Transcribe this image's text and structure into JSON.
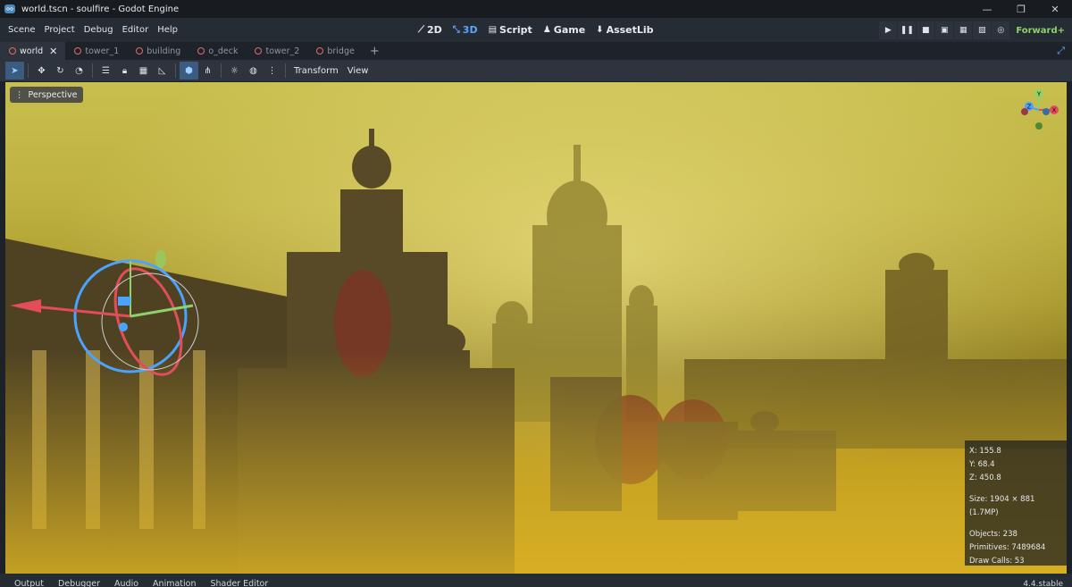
{
  "window": {
    "title": "world.tscn - soulfire - Godot Engine"
  },
  "menus": [
    "Scene",
    "Project",
    "Debug",
    "Editor",
    "Help"
  ],
  "workspaces": [
    {
      "label": "2D",
      "icon": "2d-icon"
    },
    {
      "label": "3D",
      "icon": "3d-icon"
    },
    {
      "label": "Script",
      "icon": "script-icon"
    },
    {
      "label": "Game",
      "icon": "game-icon"
    },
    {
      "label": "AssetLib",
      "icon": "assetlib-icon"
    }
  ],
  "renderer": "Forward+",
  "scene_tabs": [
    "world",
    "tower_1",
    "building",
    "o_deck",
    "tower_2",
    "bridge"
  ],
  "toolbar": {
    "transform_label": "Transform",
    "view_label": "View"
  },
  "viewport": {
    "perspective_label": "Perspective",
    "gizmo": {
      "x": "X",
      "y": "Y",
      "z": "Z"
    }
  },
  "stats": {
    "x": "X: 155.8",
    "y": "Y: 68.4",
    "z": "Z: 450.8",
    "size": "Size: 1904 × 881 (1.7MP)",
    "objects": "Objects: 238",
    "primitives": "Primitives: 7489684",
    "draw_calls": "Draw Calls: 53"
  },
  "bottom_tabs": [
    "Output",
    "Debugger",
    "Audio",
    "Animation",
    "Shader Editor"
  ],
  "version": "4.4.stable",
  "colors": {
    "accent": "#5aa7ff",
    "renderer": "#8fd16a",
    "tab_dot": "#e36b6b"
  }
}
